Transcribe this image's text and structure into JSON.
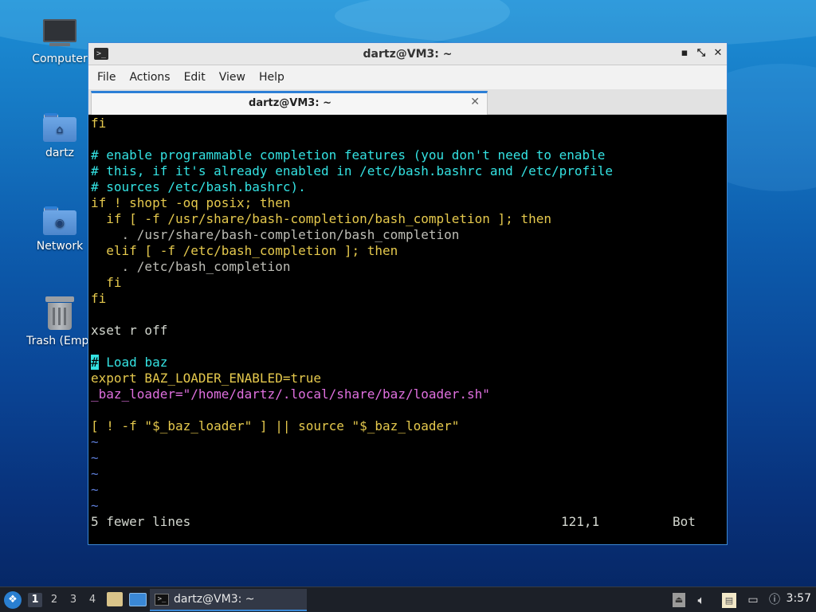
{
  "desktop": {
    "icons": [
      {
        "label": "Computer",
        "icon": "computer-icon"
      },
      {
        "label": "dartz",
        "icon": "home-folder-icon"
      },
      {
        "label": "Network",
        "icon": "network-folder-icon"
      },
      {
        "label": "Trash (Empt",
        "icon": "trash-icon"
      }
    ]
  },
  "window": {
    "title": "dartz@VM3: ~",
    "app_icon": "terminal-icon",
    "controls": {
      "minimize": "▪",
      "maximize": "⤡",
      "close": "✕"
    },
    "menu": [
      "File",
      "Actions",
      "Edit",
      "View",
      "Help"
    ],
    "tab": {
      "label": "dartz@VM3: ~",
      "close": "✕"
    },
    "accent": "#3a88d6"
  },
  "terminal": {
    "lines": [
      "fi",
      "",
      "# enable programmable completion features (you don't need to enable",
      "# this, if it's already enabled in /etc/bash.bashrc and /etc/profile",
      "# sources /etc/bash.bashrc).",
      "if ! shopt -oq posix; then",
      "  if [ -f /usr/share/bash-completion/bash_completion ]; then",
      "    . /usr/share/bash-completion/bash_completion",
      "  elif [ -f /etc/bash_completion ]; then",
      "    . /etc/bash_completion",
      "  fi",
      "fi",
      "",
      "xset r off",
      "",
      "# Load baz",
      "export BAZ_LOADER_ENABLED=true",
      "_baz_loader=\"/home/dartz/.local/share/baz/loader.sh\"",
      "",
      "[ ! -f \"$_baz_loader\" ] || source \"$_baz_loader\"",
      "~",
      "~",
      "~",
      "~",
      "~"
    ],
    "status": {
      "message": "5 fewer lines",
      "position": "121,1",
      "scroll": "Bot"
    },
    "colors": {
      "keyword": "#e5c94d",
      "comment": "#34e2e2",
      "string": "#e070e0",
      "identifier": "#6fd5ff"
    }
  },
  "taskbar": {
    "menu_icon": "lxqt-menu-icon",
    "workspaces": [
      "1",
      "2",
      "3",
      "4"
    ],
    "active_workspace": "1",
    "quick_launch": [
      "file-manager-icon",
      "show-desktop-icon"
    ],
    "task": {
      "label": "dartz@VM3: ~",
      "icon": "terminal-icon"
    },
    "tray": [
      "eject-icon",
      "volume-icon",
      "clipboard-icon",
      "network-icon",
      "update-notifier-icon"
    ],
    "clock": "3:57"
  }
}
